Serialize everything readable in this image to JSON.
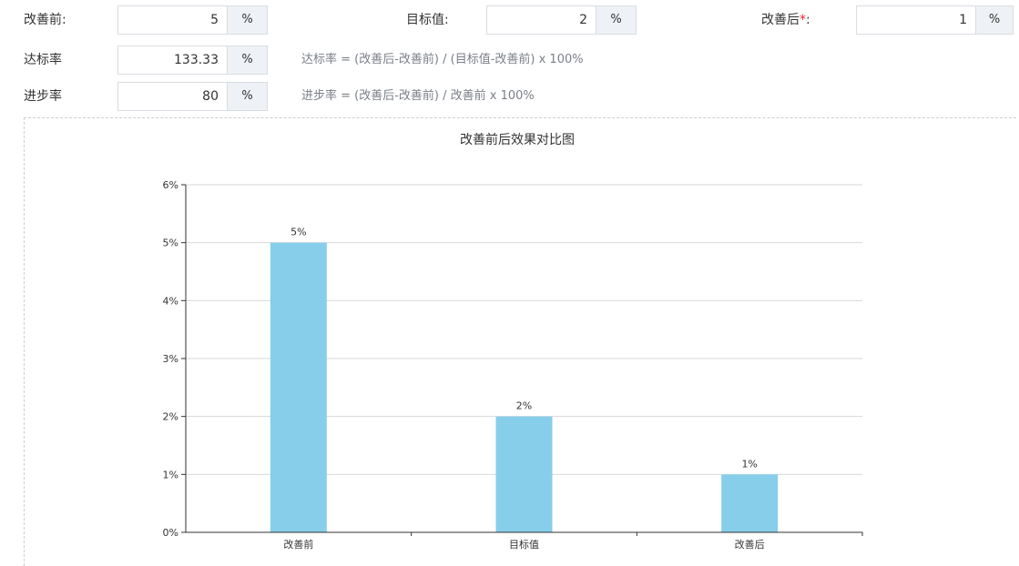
{
  "form": {
    "before": {
      "label": "改善前:",
      "value": "5",
      "unit": "%"
    },
    "target": {
      "label": "目标值:",
      "value": "2",
      "unit": "%"
    },
    "after": {
      "label": "改善后",
      "required_mark": "*",
      "colon": ":",
      "value": "1",
      "unit": "%"
    },
    "achievement": {
      "label": "达标率",
      "value": "133.33",
      "unit": "%",
      "formula": "达标率 = (改善后-改善前) / (目标值-改善前) x 100%"
    },
    "progress": {
      "label": "进步率",
      "value": "80",
      "unit": "%",
      "formula": "进步率 = (改善后-改善前) / 改善前 x 100%"
    }
  },
  "chart_data": {
    "type": "bar",
    "title": "改善前后效果对比图",
    "categories": [
      "改善前",
      "目标值",
      "改善后"
    ],
    "values": [
      5,
      2,
      1
    ],
    "value_labels": [
      "5%",
      "2%",
      "1%"
    ],
    "ylim": [
      0,
      6
    ],
    "yticks": [
      "0%",
      "1%",
      "2%",
      "3%",
      "4%",
      "5%",
      "6%"
    ],
    "grid": true,
    "colors": {
      "bar": "#87CEEB",
      "axis": "#333333",
      "grid": "#d9d9d9"
    }
  }
}
